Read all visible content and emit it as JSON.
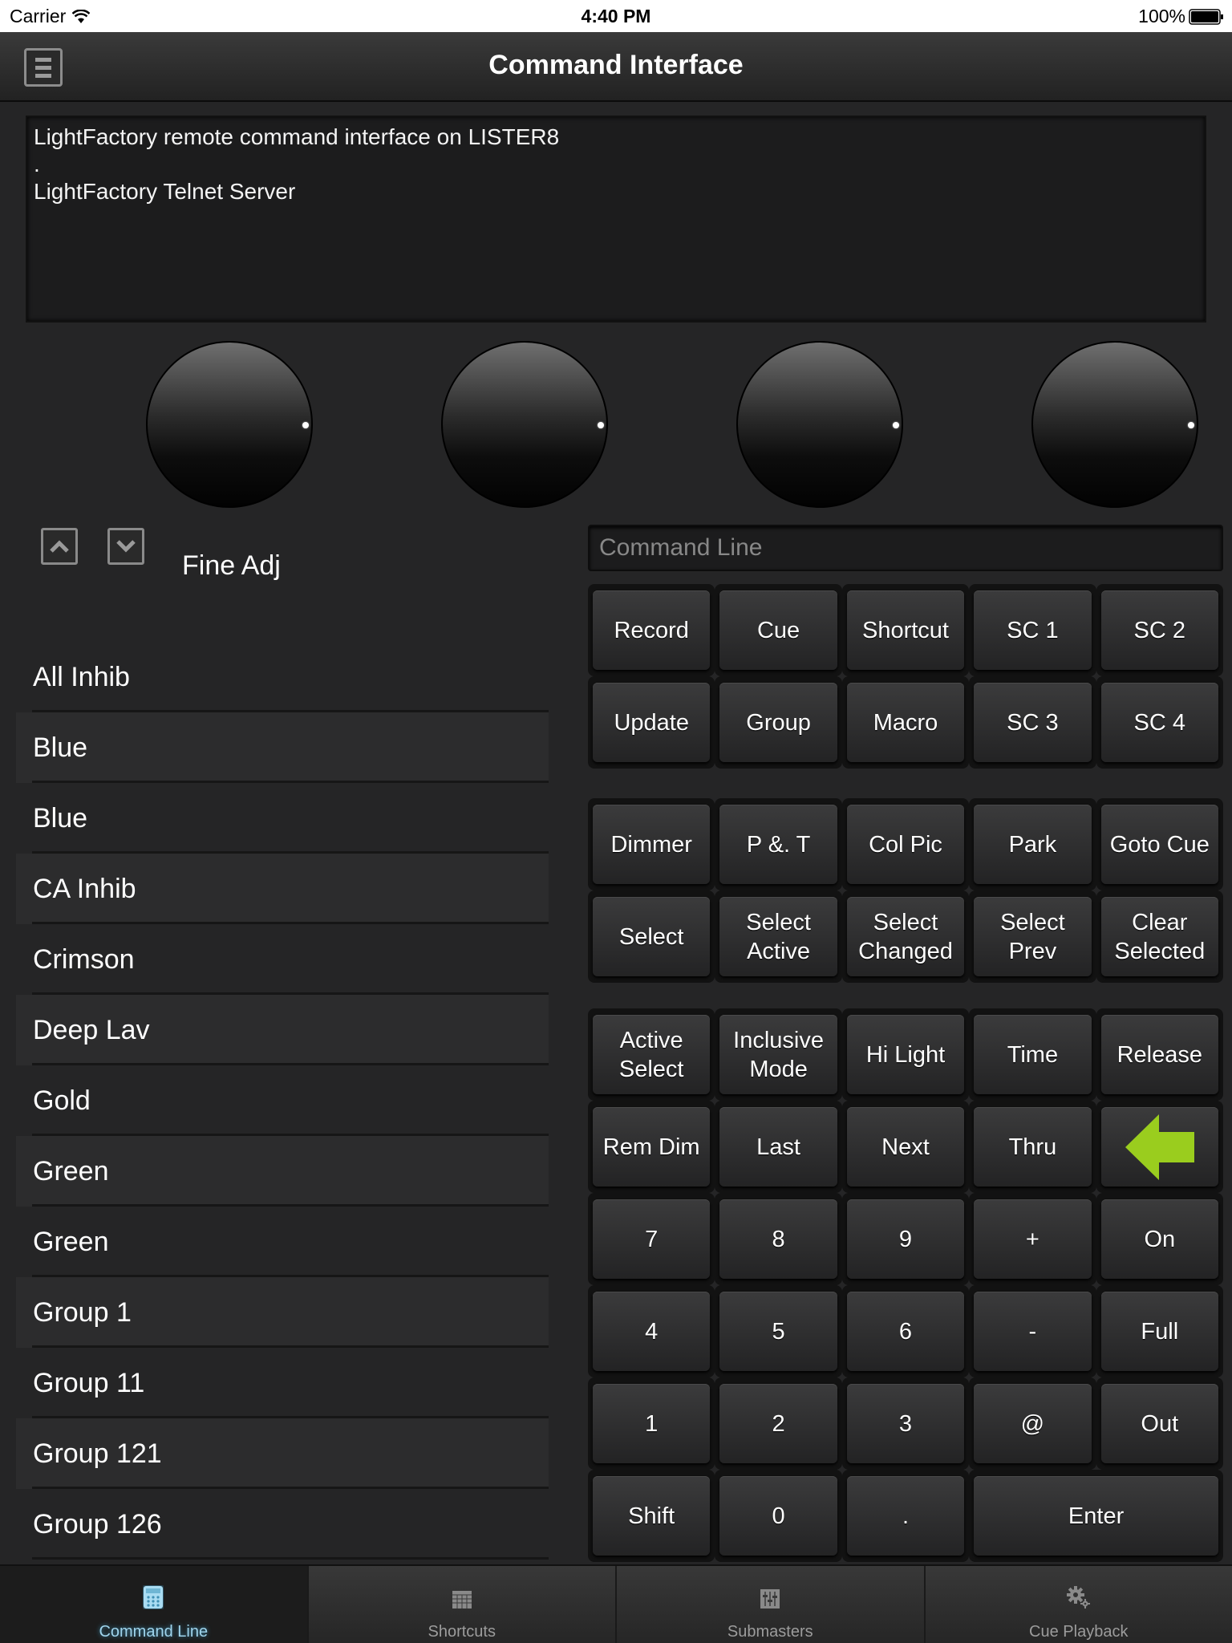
{
  "status_bar": {
    "carrier": "Carrier",
    "time": "4:40 PM",
    "battery": "100%"
  },
  "header": {
    "title": "Command Interface",
    "menu_icon": "menu-icon"
  },
  "console": {
    "lines": [
      "LightFactory remote command interface on LISTER8",
      ".",
      "LightFactory Telnet Server"
    ]
  },
  "knobs": [
    {
      "name": "encoder-1"
    },
    {
      "name": "encoder-2"
    },
    {
      "name": "encoder-3"
    },
    {
      "name": "encoder-4"
    }
  ],
  "fine_adj": {
    "label": "Fine Adj",
    "up_icon": "chevron-up-icon",
    "down_icon": "chevron-down-icon"
  },
  "list": {
    "items": [
      "All Inhib",
      "Blue",
      "Blue",
      "CA Inhib",
      "Crimson",
      "Deep Lav",
      "Gold",
      "Green",
      "Green",
      "Group 1",
      "Group 11",
      "Group 121",
      "Group 126"
    ]
  },
  "command_line": {
    "placeholder": "Command Line",
    "value": ""
  },
  "pads": {
    "block1": [
      "Record",
      "Cue",
      "Shortcut",
      "SC 1",
      "SC 2",
      "Update",
      "Group",
      "Macro",
      "SC 3",
      "SC 4"
    ],
    "block2": [
      "Dimmer",
      "P &. T",
      "Col Pic",
      "Park",
      "Goto Cue",
      "Select",
      "Select\nActive",
      "Select\nChanged",
      "Select\nPrev",
      "Clear\nSelected"
    ],
    "block3": [
      "Active\nSelect",
      "Inclusive\nMode",
      "Hi Light",
      "Time",
      "Release",
      "Rem Dim",
      "Last",
      "Next",
      "Thru",
      "",
      "7",
      "8",
      "9",
      "+",
      "On",
      "4",
      "5",
      "6",
      "-",
      "Full",
      "1",
      "2",
      "3",
      "@",
      "Out",
      "Shift",
      "0",
      ".",
      "Enter"
    ],
    "backspace_icon": "backspace-arrow-icon",
    "backspace_color": "#9acd1e"
  },
  "tabs": [
    {
      "label": "Command Line",
      "icon": "calculator-icon",
      "active": true
    },
    {
      "label": "Shortcuts",
      "icon": "grid-icon",
      "active": false
    },
    {
      "label": "Submasters",
      "icon": "sliders-icon",
      "active": false
    },
    {
      "label": "Cue Playback",
      "icon": "gears-icon",
      "active": false
    }
  ],
  "colors": {
    "active_tab": "#9fd4ec",
    "accent_arrow": "#9acd1e"
  }
}
